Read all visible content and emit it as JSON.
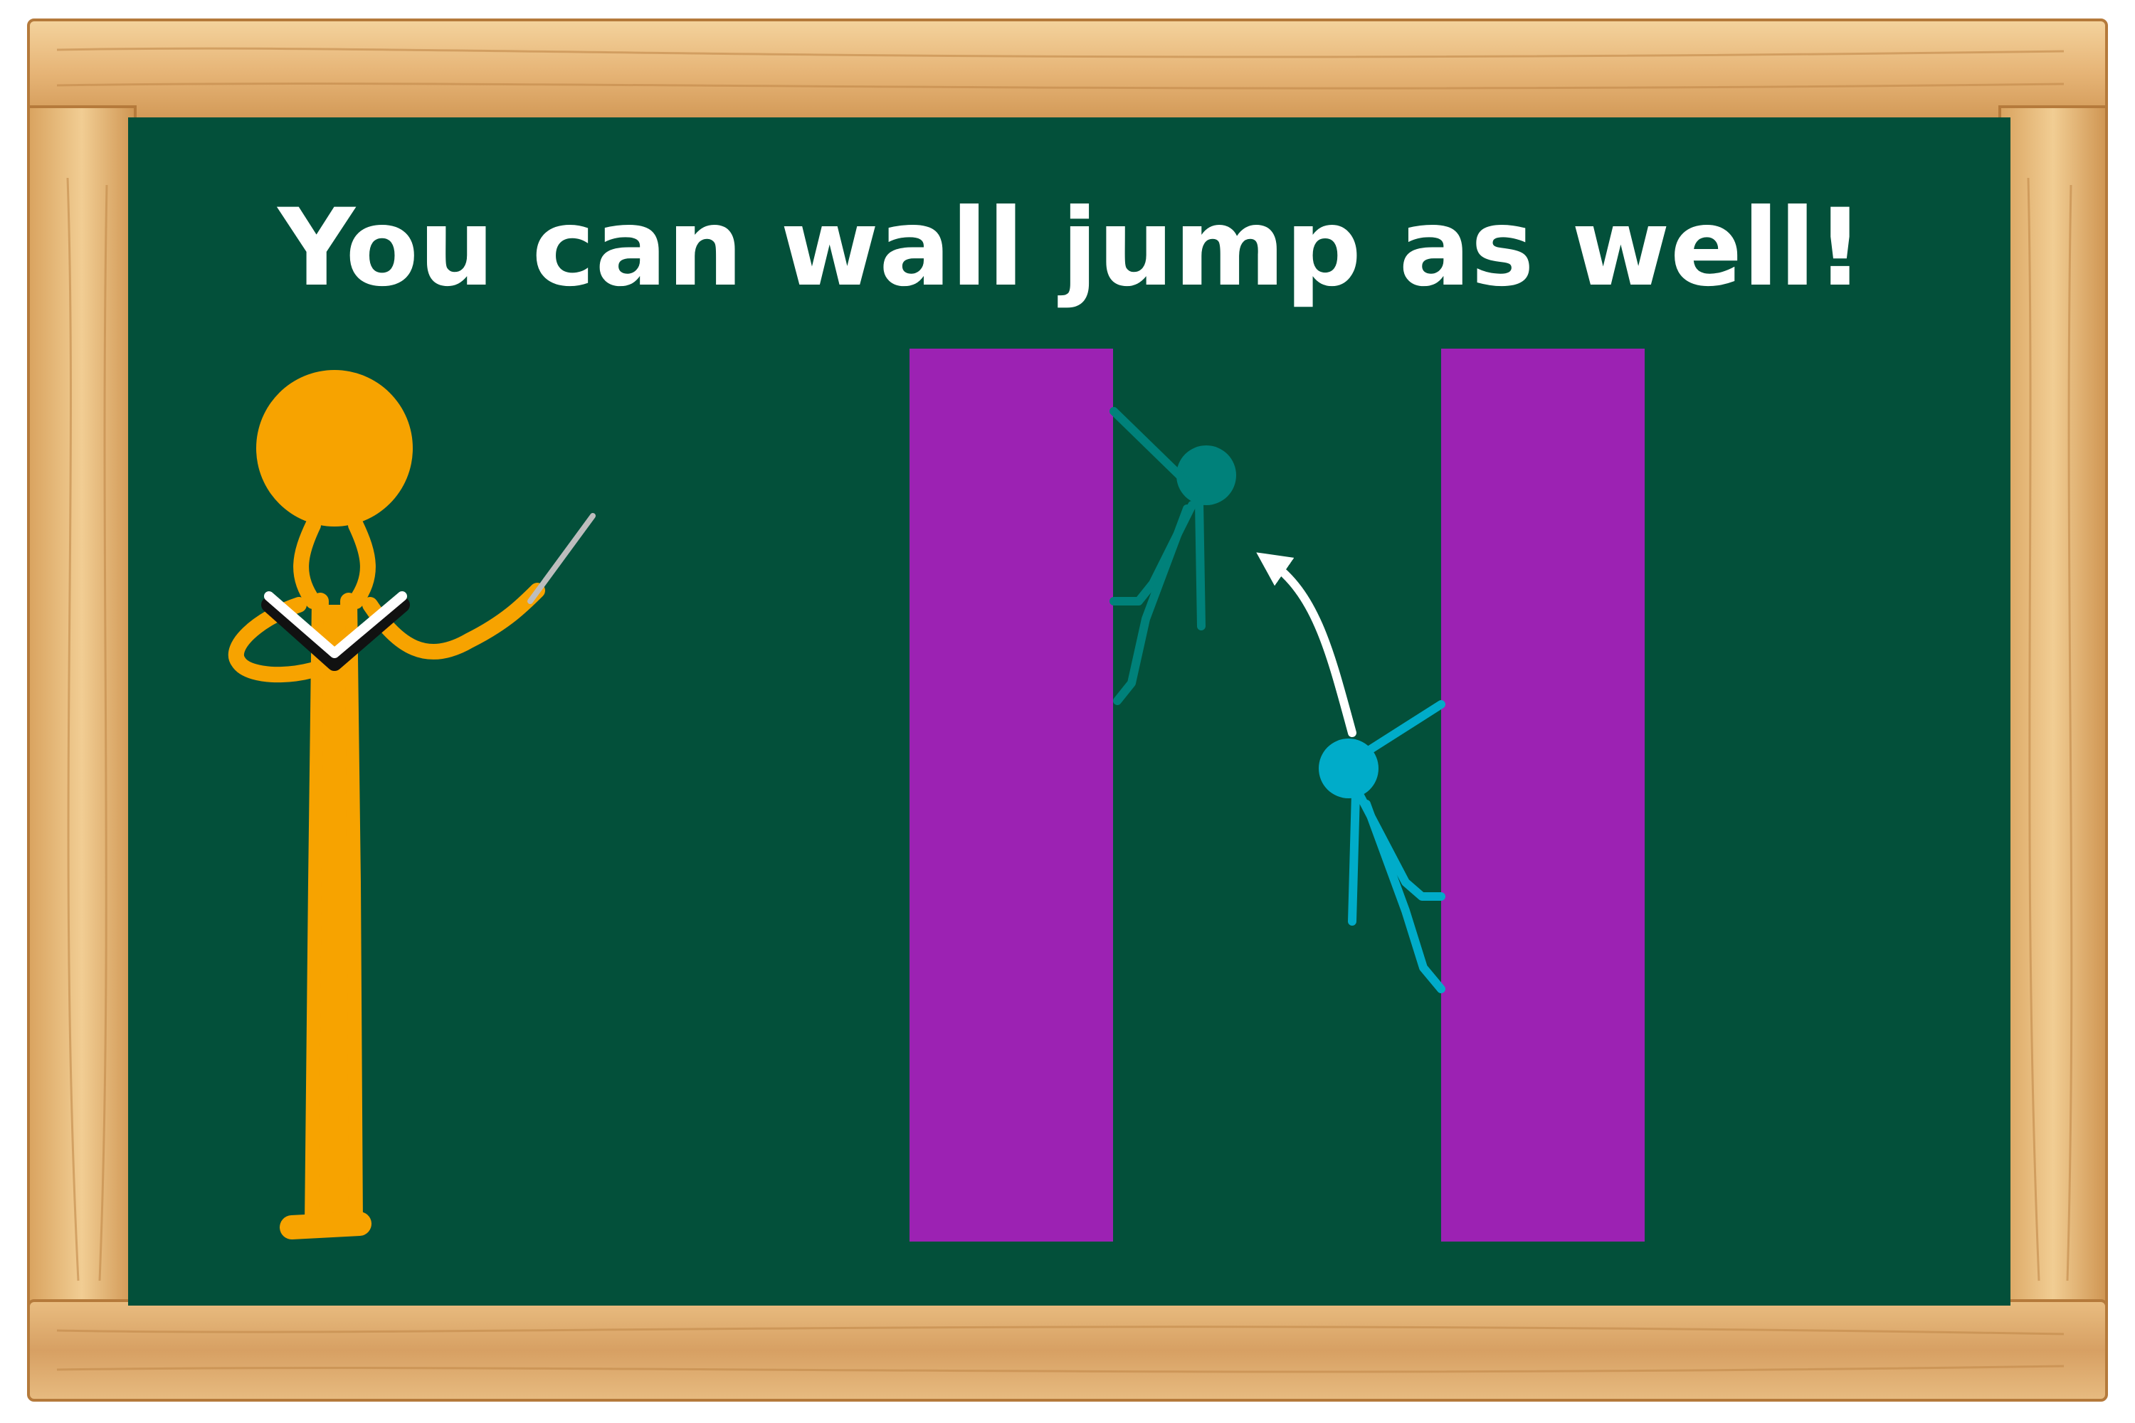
{
  "slide": {
    "headline": "You can wall jump as well!"
  },
  "colors": {
    "board": "#03503a",
    "frame_light": "#efc98c",
    "frame_mid": "#d9a35f",
    "frame_dark": "#b57a3b",
    "teacher": "#f7a300",
    "wall": "#9c22b3",
    "climber_start": "#00acc9",
    "climber_end": "#00817a",
    "arrow": "#ffffff",
    "book_pages": "#ffffff",
    "book_spine": "#111111",
    "pointer": "#bdbdbd",
    "headline": "#ffffff"
  },
  "scene_elements": {
    "teacher": "stick-figure-teacher",
    "book": "open-book-icon",
    "pointer": "pointer-stick",
    "walls": [
      "left-wall",
      "right-wall"
    ],
    "climbers": [
      "climber-on-right-wall",
      "climber-on-left-wall"
    ],
    "jump_arrow": "curved-jump-arrow-icon"
  }
}
